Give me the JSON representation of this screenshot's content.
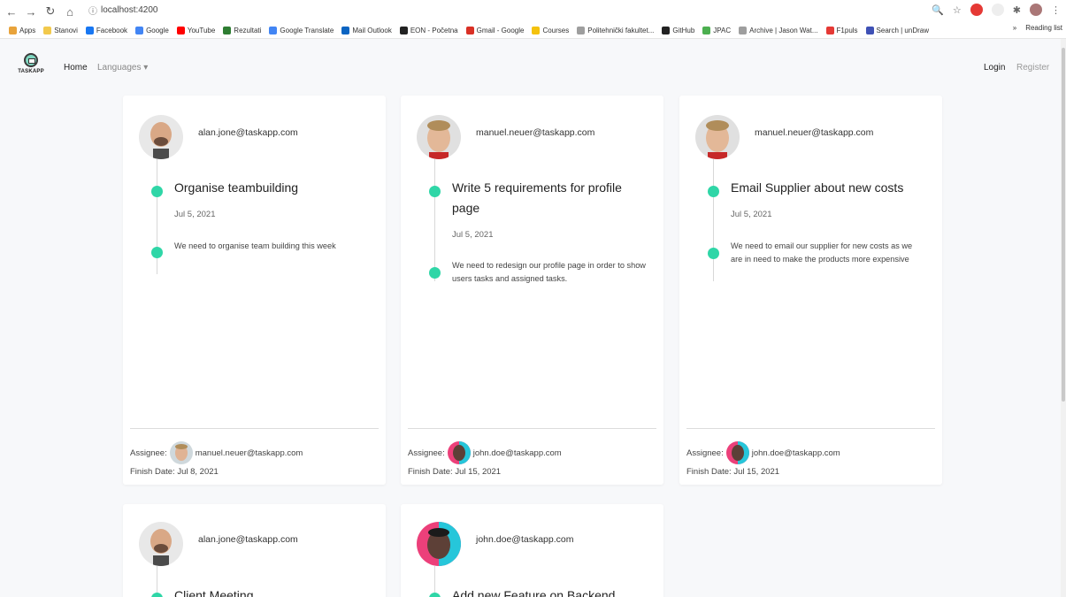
{
  "browser": {
    "url": "localhost:4200",
    "bookmarks": [
      {
        "label": "Apps",
        "color": "#e8a33b"
      },
      {
        "label": "Stanovi",
        "color": "#f2c94c"
      },
      {
        "label": "Facebook",
        "color": "#1877f2"
      },
      {
        "label": "Google",
        "color": "#4285f4"
      },
      {
        "label": "YouTube",
        "color": "#ff0000"
      },
      {
        "label": "Rezultati",
        "color": "#2e7d32"
      },
      {
        "label": "Google Translate",
        "color": "#4285f4"
      },
      {
        "label": "Mail Outlook",
        "color": "#0a64c2"
      },
      {
        "label": "EON - Početna",
        "color": "#222222"
      },
      {
        "label": "Gmail - Google",
        "color": "#d93025"
      },
      {
        "label": "Courses",
        "color": "#f4c20d"
      },
      {
        "label": "Politehnički fakultet...",
        "color": "#9e9e9e"
      },
      {
        "label": "GitHub",
        "color": "#222222"
      },
      {
        "label": "JPAC",
        "color": "#4caf50"
      },
      {
        "label": "Archive | Jason Wat...",
        "color": "#9e9e9e"
      },
      {
        "label": "F1puls",
        "color": "#e53935"
      },
      {
        "label": "Search | unDraw",
        "color": "#3f51b5"
      }
    ],
    "more": "»",
    "reading_list": "Reading list"
  },
  "navbar": {
    "logo_text": "TASKAPP",
    "home": "Home",
    "languages": "Languages",
    "login": "Login",
    "register": "Register"
  },
  "cards": [
    {
      "owner": "alan.jone@taskapp.com",
      "avatar": "bald-man",
      "title": "Organise teambuilding",
      "date": "Jul 5, 2021",
      "description": "We need to organise team building this week",
      "assignee_label": "Assignee:",
      "assignee": "manuel.neuer@taskapp.com",
      "assignee_avatar": "blond-man",
      "finish": "Finish Date: Jul 8, 2021"
    },
    {
      "owner": "manuel.neuer@taskapp.com",
      "avatar": "blond-man",
      "title": "Write 5 requirements for profile page",
      "date": "Jul 5, 2021",
      "description": "We need to redesign our profile page in order to show users tasks and assigned tasks.",
      "assignee_label": "Assignee:",
      "assignee": "john.doe@taskapp.com",
      "assignee_avatar": "dark-man",
      "finish": "Finish Date: Jul 15, 2021"
    },
    {
      "owner": "manuel.neuer@taskapp.com",
      "avatar": "blond-man",
      "title": "Email Supplier about new costs",
      "date": "Jul 5, 2021",
      "description": "We need to email our supplier for new costs as we are in need to make the products more expensive",
      "assignee_label": "Assignee:",
      "assignee": "john.doe@taskapp.com",
      "assignee_avatar": "dark-man",
      "finish": "Finish Date: Jul 15, 2021"
    },
    {
      "owner": "alan.jone@taskapp.com",
      "avatar": "bald-man",
      "title": "Client Meeting"
    },
    {
      "owner": "john.doe@taskapp.com",
      "avatar": "dark-man",
      "title": "Add new Feature on Backend"
    }
  ],
  "colors": {
    "accent": "#2fd6a7",
    "background": "#f7f8fa"
  }
}
